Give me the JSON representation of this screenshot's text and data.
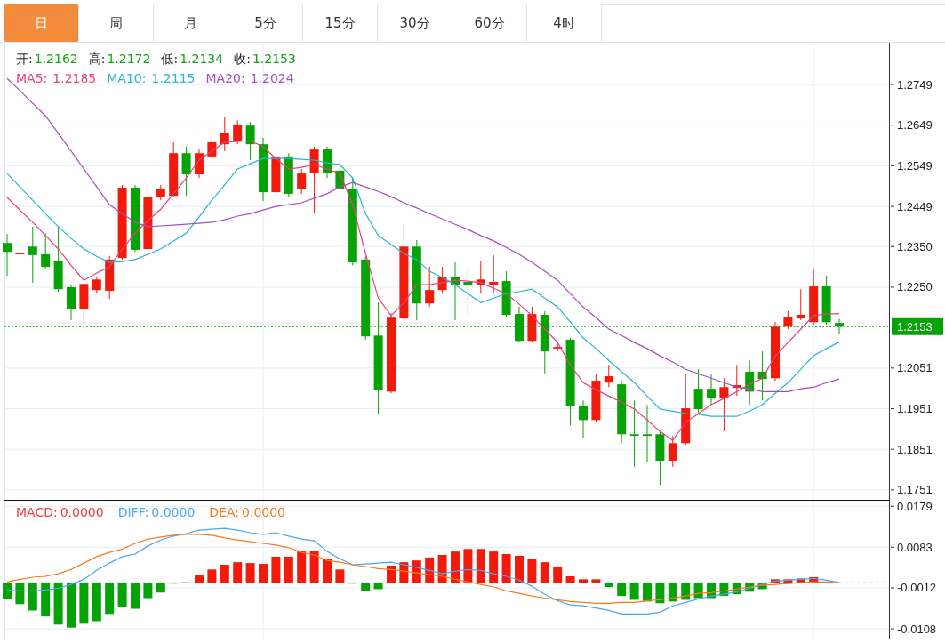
{
  "tabs": [
    {
      "label": "日",
      "selected": true
    },
    {
      "label": "周",
      "selected": false
    },
    {
      "label": "月",
      "selected": false
    },
    {
      "label": "5分",
      "selected": false
    },
    {
      "label": "15分",
      "selected": false
    },
    {
      "label": "30分",
      "selected": false
    },
    {
      "label": "60分",
      "selected": false
    },
    {
      "label": "4时",
      "selected": false
    }
  ],
  "price_chart": {
    "legend": [
      {
        "label": "开:",
        "value": "1.2162"
      },
      {
        "label": "高:",
        "value": "1.2172"
      },
      {
        "label": "低:",
        "value": "1.2134"
      },
      {
        "label": "收:",
        "value": "1.2153"
      }
    ],
    "ma_legend": [
      {
        "label": "MA5:",
        "value": "1.2185",
        "color": "#e8407b"
      },
      {
        "label": "MA10:",
        "value": "1.2115",
        "color": "#27b5d6"
      },
      {
        "label": "MA20:",
        "value": "1.2024",
        "color": "#a64ec0"
      }
    ],
    "last_price": "1.2153",
    "chart_data": {
      "type": "candlestick",
      "ylim": [
        1.1731,
        1.2852
      ],
      "grid": true,
      "ref_lines": [
        {
          "axis": "y",
          "value": 1.2153,
          "color": "#13a513"
        }
      ],
      "yticks": [
        {
          "value": 1.2749,
          "label": "1.2749"
        },
        {
          "value": 1.2649,
          "label": "1.2649"
        },
        {
          "value": 1.2549,
          "label": "1.2549"
        },
        {
          "value": 1.2449,
          "label": "1.2449"
        },
        {
          "value": 1.235,
          "label": "1.2350"
        },
        {
          "value": 1.225,
          "label": "1.2250"
        },
        {
          "value": 1.2051,
          "label": "1.2051"
        },
        {
          "value": 1.1951,
          "label": "1.1951"
        },
        {
          "value": 1.1851,
          "label": "1.1851"
        },
        {
          "value": 1.1751,
          "label": "1.1751"
        }
      ],
      "ohlc": [
        [
          1.2359,
          1.2381,
          1.2278,
          1.2337
        ],
        [
          1.2331,
          1.2335,
          1.2329,
          1.2333
        ],
        [
          1.235,
          1.2399,
          1.2261,
          1.2329
        ],
        [
          1.2331,
          1.2383,
          1.2294,
          1.23
        ],
        [
          1.2315,
          1.2399,
          1.2239,
          1.2245
        ],
        [
          1.225,
          1.2256,
          1.2169,
          1.2197
        ],
        [
          1.2195,
          1.2261,
          1.2158,
          1.2258
        ],
        [
          1.2243,
          1.2276,
          1.2234,
          1.2269
        ],
        [
          1.2241,
          1.2327,
          1.2221,
          1.2318
        ],
        [
          1.2322,
          1.2502,
          1.2318,
          1.2495
        ],
        [
          1.2495,
          1.2502,
          1.2337,
          1.2342
        ],
        [
          1.2344,
          1.2502,
          1.2337,
          1.2471
        ],
        [
          1.2471,
          1.2502,
          1.2464,
          1.2493
        ],
        [
          1.2475,
          1.2607,
          1.2471,
          1.258
        ],
        [
          1.258,
          1.2596,
          1.2475,
          1.2528
        ],
        [
          1.2528,
          1.2589,
          1.2519,
          1.258
        ],
        [
          1.2572,
          1.2629,
          1.2563,
          1.2607
        ],
        [
          1.2602,
          1.2668,
          1.2585,
          1.2629
        ],
        [
          1.2611,
          1.2661,
          1.2602,
          1.265
        ],
        [
          1.2648,
          1.2657,
          1.2563,
          1.2602
        ],
        [
          1.2602,
          1.2618,
          1.2462,
          1.2484
        ],
        [
          1.2484,
          1.258,
          1.2475,
          1.2572
        ],
        [
          1.2572,
          1.258,
          1.2471,
          1.248
        ],
        [
          1.2491,
          1.2541,
          1.248,
          1.253
        ],
        [
          1.2532,
          1.2596,
          1.2431,
          1.2589
        ],
        [
          1.2589,
          1.2596,
          1.2519,
          1.2532
        ],
        [
          1.2537,
          1.2563,
          1.2486,
          1.2493
        ],
        [
          1.2493,
          1.2519,
          1.2304,
          1.2311
        ],
        [
          1.2318,
          1.2326,
          1.2121,
          1.2129
        ],
        [
          1.2131,
          1.2212,
          1.1937,
          1.1998
        ],
        [
          1.1993,
          1.2186,
          1.1989,
          1.2175
        ],
        [
          1.2173,
          1.2405,
          1.2164,
          1.235
        ],
        [
          1.235,
          1.2366,
          1.2169,
          1.221
        ],
        [
          1.221,
          1.23,
          1.2202,
          1.2243
        ],
        [
          1.2243,
          1.23,
          1.2234,
          1.2276
        ],
        [
          1.2276,
          1.2311,
          1.2169,
          1.2256
        ],
        [
          1.2263,
          1.23,
          1.2173,
          1.2256
        ],
        [
          1.2256,
          1.2315,
          1.2234,
          1.2269
        ],
        [
          1.2256,
          1.2329,
          1.2234,
          1.2263
        ],
        [
          1.2265,
          1.2289,
          1.2177,
          1.2182
        ],
        [
          1.2184,
          1.2202,
          1.2114,
          1.2118
        ],
        [
          1.2118,
          1.2202,
          1.2114,
          1.2184
        ],
        [
          1.2182,
          1.2191,
          1.2038,
          1.2092
        ],
        [
          1.2099,
          1.2114,
          1.2092,
          1.2103
        ],
        [
          1.2121,
          1.2125,
          1.191,
          1.1958
        ],
        [
          1.1958,
          1.1971,
          1.188,
          1.1923
        ],
        [
          1.1923,
          1.2037,
          1.1917,
          1.202
        ],
        [
          1.2015,
          1.2059,
          1.2004,
          1.2031
        ],
        [
          1.2011,
          1.202,
          1.1866,
          1.1888
        ],
        [
          1.1888,
          1.1971,
          1.1808,
          1.1884
        ],
        [
          1.1888,
          1.196,
          1.1819,
          1.1884
        ],
        [
          1.1888,
          1.1895,
          1.1763,
          1.1823
        ],
        [
          1.1823,
          1.1884,
          1.1808,
          1.1866
        ],
        [
          1.1866,
          1.2037,
          1.1862,
          1.1952
        ],
        [
          1.2,
          1.2048,
          1.1939,
          1.195
        ],
        [
          1.2,
          1.2037,
          1.1961,
          1.1976
        ],
        [
          1.1976,
          1.2026,
          1.1895,
          1.2004
        ],
        [
          1.2002,
          1.2059,
          1.1983,
          1.2009
        ],
        [
          1.2042,
          1.207,
          1.1961,
          1.1993
        ],
        [
          1.2042,
          1.2092,
          1.1971,
          1.2024
        ],
        [
          1.2026,
          1.2164,
          1.202,
          1.2153
        ],
        [
          1.2153,
          1.2191,
          1.2147,
          1.2177
        ],
        [
          1.2173,
          1.2245,
          1.2169,
          1.2182
        ],
        [
          1.2164,
          1.2294,
          1.2158,
          1.2252
        ],
        [
          1.2252,
          1.2278,
          1.2158,
          1.2164
        ],
        [
          1.2162,
          1.2172,
          1.2134,
          1.2153
        ]
      ],
      "series": [
        {
          "type": "line",
          "color": "#e8407b",
          "values": [
            1.2471,
            1.244,
            1.241,
            1.2377,
            1.2344,
            1.2304,
            1.2267,
            1.2285,
            1.23,
            1.2344,
            1.2383,
            1.2414,
            1.2442,
            1.248,
            1.2519,
            1.2563,
            1.2585,
            1.2607,
            1.2609,
            1.2611,
            1.2596,
            1.2567,
            1.2541,
            1.2545,
            1.2552,
            1.2541,
            1.253,
            1.2453,
            1.2333,
            1.2223,
            1.218,
            1.2212,
            1.2256,
            1.2256,
            1.2261,
            1.2267,
            1.2265,
            1.2261,
            1.2247,
            1.2234,
            1.2208,
            1.218,
            1.2147,
            1.2114,
            1.2059,
            1.2015,
            1.1998,
            1.1982,
            1.1967,
            1.195,
            1.1923,
            1.1895,
            1.1873,
            1.1917,
            1.1939,
            1.1961,
            1.1976,
            1.1993,
            1.2011,
            1.2026,
            1.2081,
            1.2114,
            1.2147,
            1.218,
            1.2184,
            1.2185
          ]
        },
        {
          "type": "line",
          "color": "#27b5d6",
          "values": [
            1.253,
            1.2497,
            1.2464,
            1.2431,
            1.2399,
            1.237,
            1.2344,
            1.2326,
            1.2311,
            1.2313,
            1.2318,
            1.2331,
            1.2344,
            1.2364,
            1.2383,
            1.2423,
            1.2464,
            1.2502,
            1.2541,
            1.2554,
            1.2567,
            1.2567,
            1.2567,
            1.2565,
            1.2563,
            1.2556,
            1.2552,
            1.2519,
            1.2431,
            1.2377,
            1.2355,
            1.2333,
            1.2318,
            1.2289,
            1.2274,
            1.2256,
            1.2234,
            1.2212,
            1.2223,
            1.2234,
            1.2239,
            1.2245,
            1.2223,
            1.2201,
            1.2164,
            1.2125,
            1.2099,
            1.207,
            1.2042,
            1.2015,
            1.1982,
            1.195,
            1.1945,
            1.1939,
            1.1937,
            1.1932,
            1.1932,
            1.1932,
            1.1945,
            1.1961,
            1.1989,
            1.2015,
            1.2048,
            1.2081,
            1.2099,
            1.2115
          ]
        },
        {
          "type": "line",
          "color": "#a64ec0",
          "values": [
            1.2764,
            1.2734,
            1.2703,
            1.2672,
            1.2629,
            1.2585,
            1.2541,
            1.2497,
            1.2453,
            1.2431,
            1.241,
            1.2399,
            1.2401,
            1.2403,
            1.2405,
            1.2407,
            1.241,
            1.2416,
            1.2425,
            1.2431,
            1.244,
            1.2449,
            1.2453,
            1.2458,
            1.2469,
            1.248,
            1.2497,
            1.2508,
            1.2497,
            1.2486,
            1.2473,
            1.2458,
            1.2445,
            1.2431,
            1.2418,
            1.2405,
            1.2392,
            1.2377,
            1.2364,
            1.2348,
            1.2331,
            1.2311,
            1.2289,
            1.2267,
            1.2234,
            1.2201,
            1.2175,
            1.2147,
            1.2131,
            1.2114,
            1.2099,
            1.2081,
            1.2066,
            1.2048,
            1.2037,
            1.2026,
            1.2015,
            1.2004,
            1.2,
            1.1993,
            1.1993,
            1.1993,
            1.2,
            1.2004,
            1.2015,
            1.2024
          ]
        }
      ]
    }
  },
  "macd_chart": {
    "legend": [
      {
        "label": "MACD:",
        "value": "0.0000",
        "color": "#f03c3c"
      },
      {
        "label": "DIFF:",
        "value": "0.0000",
        "color": "#4aa6ee"
      },
      {
        "label": "DEA:",
        "value": "0.0000",
        "color": "#f57a1f"
      }
    ],
    "chart_data": {
      "type": "bar",
      "ylim": [
        -0.0139,
        0.0194
      ],
      "grid": true,
      "ref_lines": [
        {
          "axis": "y",
          "value": 0,
          "color": "#8fcbe8"
        }
      ],
      "yticks": [
        {
          "value": 0.0179,
          "label": "0.0179"
        },
        {
          "value": 0.0083,
          "label": "0.0083"
        },
        {
          "value": -0.0012,
          "label": "-0.0012"
        },
        {
          "value": -0.0108,
          "label": "-0.0108"
        }
      ],
      "series": [
        {
          "type": "bar",
          "colors": [
            "#06a306",
            "#06a306",
            "#06a306",
            "#06a306",
            "#06a306",
            "#06a306",
            "#06a306",
            "#06a306",
            "#06a306",
            "#06a306",
            "#06a306",
            "#06a306",
            "#06a306",
            "#06a306",
            "#f21a0a",
            "#f21a0a",
            "#f21a0a",
            "#f21a0a",
            "#f21a0a",
            "#f21a0a",
            "#f21a0a",
            "#f21a0a",
            "#f21a0a",
            "#f21a0a",
            "#f21a0a",
            "#f21a0a",
            "#f21a0a",
            "#06a306",
            "#06a306",
            "#06a306",
            "#f21a0a",
            "#f21a0a",
            "#f21a0a",
            "#f21a0a",
            "#f21a0a",
            "#f21a0a",
            "#f21a0a",
            "#f21a0a",
            "#f21a0a",
            "#f21a0a",
            "#f21a0a",
            "#f21a0a",
            "#f21a0a",
            "#f21a0a",
            "#f21a0a",
            "#f21a0a",
            "#f21a0a",
            "#06a306",
            "#06a306",
            "#06a306",
            "#06a306",
            "#06a306",
            "#06a306",
            "#06a306",
            "#06a306",
            "#06a306",
            "#06a306",
            "#06a306",
            "#06a306",
            "#06a306",
            "#f21a0a",
            "#f21a0a",
            "#f21a0a",
            "#f21a0a",
            null,
            null
          ],
          "values": [
            -0.0038,
            -0.005,
            -0.0065,
            -0.0079,
            -0.0098,
            -0.0105,
            -0.0096,
            -0.009,
            -0.0073,
            -0.0056,
            -0.0061,
            -0.0036,
            -0.0023,
            -0.0002,
            0.0001,
            0.0019,
            0.0031,
            0.0042,
            0.0048,
            0.0046,
            0.0044,
            0.0061,
            0.0061,
            0.0073,
            0.0075,
            0.0056,
            0.0031,
            -0.0001,
            -0.0019,
            -0.0015,
            0.004,
            0.0048,
            0.0052,
            0.0059,
            0.0065,
            0.0073,
            0.0079,
            0.0079,
            0.0073,
            0.0067,
            0.0063,
            0.0056,
            0.0048,
            0.0038,
            0.0015,
            0.0008,
            0.0008,
            -0.001,
            -0.0031,
            -0.004,
            -0.0044,
            -0.0048,
            -0.0044,
            -0.004,
            -0.0036,
            -0.0036,
            -0.0031,
            -0.0027,
            -0.0021,
            -0.0015,
            0.0008,
            0.0008,
            0.001,
            0.0013,
            null,
            null
          ]
        },
        {
          "type": "line",
          "color": "#4aa6ee",
          "values": [
            -0.0017,
            -0.0019,
            -0.0019,
            -0.0017,
            -0.0013,
            -0.0004,
            0.0008,
            0.0029,
            0.0046,
            0.0061,
            0.0067,
            0.0086,
            0.01,
            0.0109,
            0.0115,
            0.0123,
            0.0125,
            0.0127,
            0.0123,
            0.0117,
            0.0113,
            0.0117,
            0.0109,
            0.0102,
            0.0098,
            0.0073,
            0.0056,
            0.0042,
            0.0044,
            0.0046,
            0.0048,
            0.0042,
            0.0036,
            0.0029,
            0.0021,
            0.0027,
            0.0031,
            0.0029,
            0.0021,
            0.0015,
            0.0006,
            -0.0008,
            -0.0027,
            -0.0042,
            -0.0052,
            -0.0054,
            -0.0059,
            -0.0065,
            -0.0073,
            -0.0073,
            -0.0073,
            -0.0069,
            -0.0054,
            -0.0046,
            -0.0038,
            -0.0031,
            -0.0027,
            -0.0021,
            -0.0013,
            -0.0004,
            0.0004,
            0.0006,
            0.0008,
            0.001,
            0.0006,
            0.0
          ]
        },
        {
          "type": "line",
          "color": "#f57a1f",
          "values": [
            0.0002,
            0.0008,
            0.0013,
            0.0015,
            0.0021,
            0.0031,
            0.0046,
            0.0061,
            0.0071,
            0.0079,
            0.0092,
            0.0102,
            0.0107,
            0.0111,
            0.0113,
            0.0113,
            0.0111,
            0.0105,
            0.01,
            0.0096,
            0.0092,
            0.0088,
            0.0082,
            0.0071,
            0.0065,
            0.0052,
            0.0048,
            0.0042,
            0.0038,
            0.0033,
            0.0031,
            0.0027,
            0.0023,
            0.0019,
            0.0015,
            0.0008,
            0.0002,
            -0.0004,
            -0.001,
            -0.0019,
            -0.0025,
            -0.0031,
            -0.0036,
            -0.004,
            -0.0044,
            -0.0046,
            -0.0048,
            -0.0048,
            -0.0046,
            -0.0046,
            -0.0042,
            -0.004,
            -0.0036,
            -0.0031,
            -0.0025,
            -0.0023,
            -0.0019,
            -0.0015,
            -0.001,
            -0.0006,
            -0.0004,
            -0.0002,
            0.0,
            0.0002,
            0.0002,
            0.0
          ]
        }
      ]
    }
  }
}
